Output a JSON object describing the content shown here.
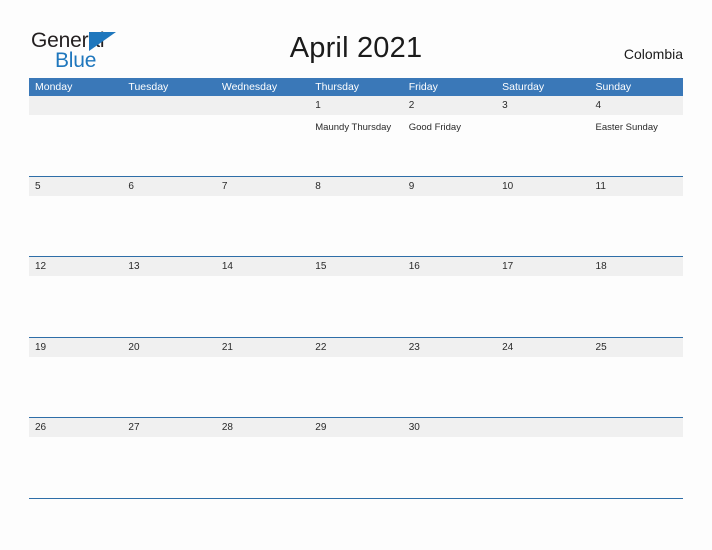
{
  "brand": {
    "name_part1": "General",
    "name_part2": "Blue",
    "triangle_icon": "triangle-right-icon",
    "accent_color": "#1f77bd"
  },
  "header": {
    "title": "April 2021",
    "locale": "Colombia"
  },
  "colors": {
    "weekday_header_bg": "#3a78b8",
    "daynum_band_bg": "#f0f0f0",
    "row_separator": "#2e6ea8",
    "page_bg": "#fdfdfd",
    "text": "#2a2a2a"
  },
  "calendar": {
    "month": "April",
    "year": "2021",
    "weekdays": [
      "Monday",
      "Tuesday",
      "Wednesday",
      "Thursday",
      "Friday",
      "Saturday",
      "Sunday"
    ],
    "weeks": [
      {
        "days": [
          {
            "num": "",
            "event": ""
          },
          {
            "num": "",
            "event": ""
          },
          {
            "num": "",
            "event": ""
          },
          {
            "num": "1",
            "event": "Maundy Thursday"
          },
          {
            "num": "2",
            "event": "Good Friday"
          },
          {
            "num": "3",
            "event": ""
          },
          {
            "num": "4",
            "event": "Easter Sunday"
          }
        ]
      },
      {
        "days": [
          {
            "num": "5",
            "event": ""
          },
          {
            "num": "6",
            "event": ""
          },
          {
            "num": "7",
            "event": ""
          },
          {
            "num": "8",
            "event": ""
          },
          {
            "num": "9",
            "event": ""
          },
          {
            "num": "10",
            "event": ""
          },
          {
            "num": "11",
            "event": ""
          }
        ]
      },
      {
        "days": [
          {
            "num": "12",
            "event": ""
          },
          {
            "num": "13",
            "event": ""
          },
          {
            "num": "14",
            "event": ""
          },
          {
            "num": "15",
            "event": ""
          },
          {
            "num": "16",
            "event": ""
          },
          {
            "num": "17",
            "event": ""
          },
          {
            "num": "18",
            "event": ""
          }
        ]
      },
      {
        "days": [
          {
            "num": "19",
            "event": ""
          },
          {
            "num": "20",
            "event": ""
          },
          {
            "num": "21",
            "event": ""
          },
          {
            "num": "22",
            "event": ""
          },
          {
            "num": "23",
            "event": ""
          },
          {
            "num": "24",
            "event": ""
          },
          {
            "num": "25",
            "event": ""
          }
        ]
      },
      {
        "days": [
          {
            "num": "26",
            "event": ""
          },
          {
            "num": "27",
            "event": ""
          },
          {
            "num": "28",
            "event": ""
          },
          {
            "num": "29",
            "event": ""
          },
          {
            "num": "30",
            "event": ""
          },
          {
            "num": "",
            "event": ""
          },
          {
            "num": "",
            "event": ""
          }
        ]
      }
    ]
  }
}
